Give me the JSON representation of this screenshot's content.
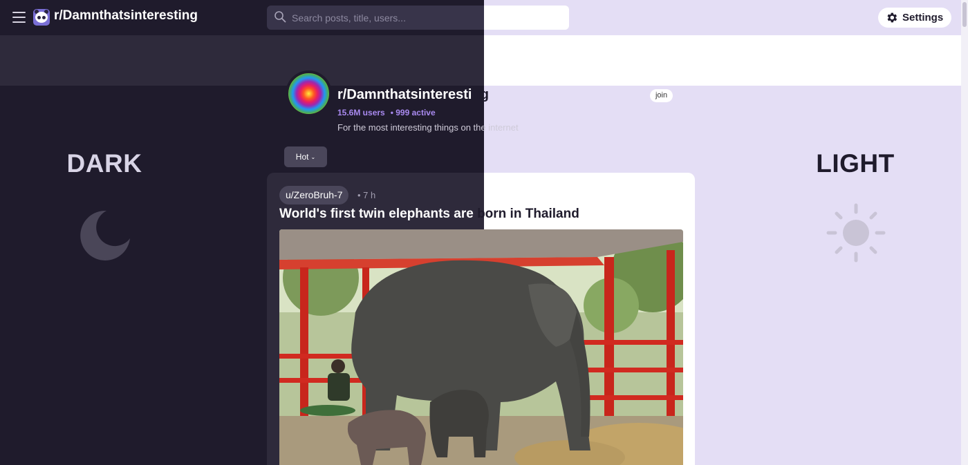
{
  "header": {
    "site_title": "r/Damnthatsinteresting",
    "search_placeholder": "Search posts, title, users...",
    "settings_label": "Settings"
  },
  "themes": {
    "dark_label": "DARK",
    "light_label": "LIGHT"
  },
  "community": {
    "name_dark_part": "r/Damnthatsinteresti",
    "name_light_part": "ng",
    "users": "15.6M users",
    "active": "• 999 active",
    "description": "For the most interesting things on the internet",
    "join_label": "join"
  },
  "sort": {
    "selected": "Hot"
  },
  "post": {
    "author": "u/ZeroBruh-7",
    "time": "• 7 h",
    "title_dark_part": "World's first twin elephants are ",
    "title_light_part": "born in Thailand"
  },
  "colors": {
    "dark_bg": "#1f1b2c",
    "light_bg": "#e4def5",
    "accent": "#a98af0"
  }
}
